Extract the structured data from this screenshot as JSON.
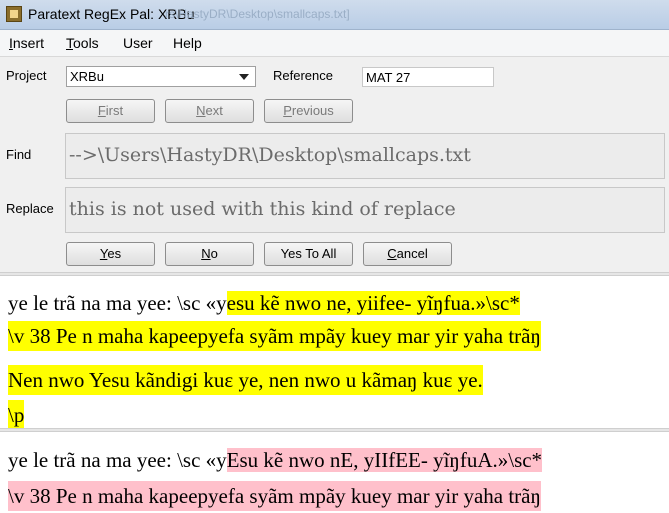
{
  "window": {
    "title": "Paratext RegEx Pal: XRBu",
    "ghost_title": "rs\\HastyDR\\Desktop\\smallcaps.txt]"
  },
  "menu": [
    "Insert",
    "Tools",
    "User",
    "Help"
  ],
  "form": {
    "project_label": "Project",
    "project_value": "XRBu",
    "reference_label": "Reference",
    "reference_value": "MAT 27",
    "find_label": "Find",
    "find_value": "-->\\Users\\HastyDR\\Desktop\\smallcaps.txt",
    "replace_label": "Replace",
    "replace_value": "this is not used with this kind of replace"
  },
  "nav_buttons": {
    "first": "First",
    "next": "Next",
    "previous": "Previous"
  },
  "action_buttons": {
    "yes": "Yes",
    "no": "No",
    "yes_to_all": "Yes To All",
    "cancel": "Cancel"
  },
  "preview_top": {
    "line1_plain": "ye le trã na ma yee: \\sc «y",
    "line1_match": "esu kẽ nwo ne, yiifee- yĩŋfua.»\\sc*",
    "line2": "\\v 38 Pe n maha kapeepyefa syãm mpãy kuey mar yir yaha trãŋ",
    "line3": "Nen nwo Yesu kãndigi kuɛ ye, nen nwo u kãmaŋ kuɛ ye.",
    "line4": "\\p"
  },
  "preview_bottom": {
    "line1_plain": "ye le trã na ma yee: \\sc «y",
    "line1_match": "Esu kẽ nwo nE, yIIfEE- yĩŋfuA.»\\sc*",
    "line2": "\\v 38 Pe n maha kapeepyefa syãm mpãy kuey mar yir yaha trãŋ"
  }
}
